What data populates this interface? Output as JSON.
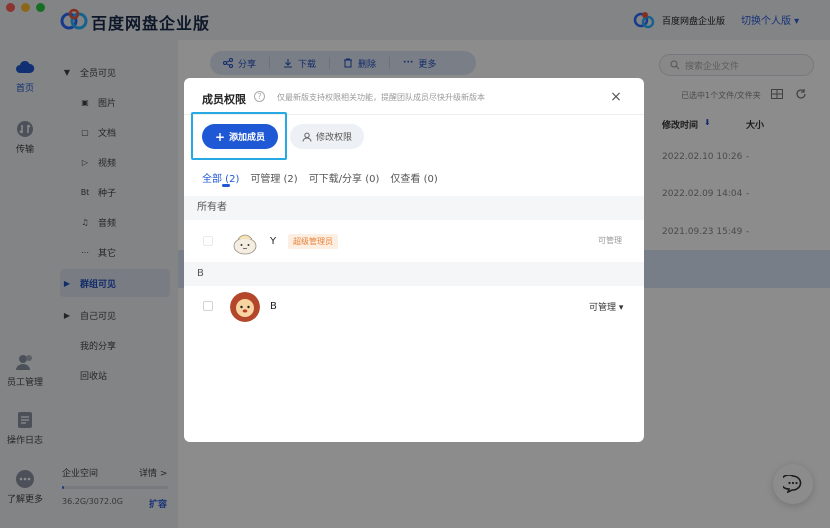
{
  "app": {
    "title": "百度网盘企业版",
    "enterprise_name": "百度网盘企业版",
    "switch_label": "切换个人版 ▾"
  },
  "rail": [
    {
      "label": "首页",
      "icon": "cloud-icon"
    },
    {
      "label": "传输",
      "icon": "transfer-icon"
    },
    {
      "label": "员工管理",
      "icon": "staff-icon"
    },
    {
      "label": "操作日志",
      "icon": "log-icon"
    },
    {
      "label": "了解更多",
      "icon": "more-icon"
    }
  ],
  "sidebar": {
    "items": [
      {
        "label": "全员可见",
        "icon": "caret-down-icon"
      },
      {
        "label": "图片",
        "icon": "image-icon"
      },
      {
        "label": "文档",
        "icon": "document-icon"
      },
      {
        "label": "视频",
        "icon": "video-icon"
      },
      {
        "label": "种子",
        "icon": "torrent-icon"
      },
      {
        "label": "音频",
        "icon": "audio-icon"
      },
      {
        "label": "其它",
        "icon": "other-icon"
      },
      {
        "label": "群组可见",
        "icon": "caret-right-icon"
      },
      {
        "label": "自己可见",
        "icon": "caret-right-icon"
      },
      {
        "label": "我的分享",
        "icon": ""
      },
      {
        "label": "回收站",
        "icon": ""
      }
    ],
    "quota_label": "企业空间",
    "quota_detail": "详情 >",
    "quota_value": "36.2G/3072.0G",
    "quota_fraction": 0.012,
    "expand_label": "扩容"
  },
  "toolbar": {
    "share": "分享",
    "download": "下载",
    "delete": "删除",
    "more": "更多"
  },
  "search": {
    "placeholder": "搜索企业文件"
  },
  "file_list": {
    "selection_info": "已选中1个文件/文件夹",
    "col_modified": "修改时间",
    "col_size": "大小",
    "rows": [
      {
        "date": "2022.02.10 10:26",
        "size": "-"
      },
      {
        "date": "2022.02.09 14:04",
        "size": "-"
      },
      {
        "date": "2021.09.23 15:49",
        "size": "-"
      }
    ]
  },
  "dialog": {
    "title": "成员权限",
    "help": "?",
    "note": "仅最新版支持权限相关功能，提醒团队成员尽快升级新版本",
    "close": "×",
    "add_member": "添加成员",
    "modify_permission": "修改权限",
    "tabs": [
      {
        "label": "全部 (2)"
      },
      {
        "label": "可管理 (2)"
      },
      {
        "label": "可下载/分享 (0)"
      },
      {
        "label": "仅查看 (0)"
      }
    ],
    "owner_group": "所有者",
    "owner": {
      "name": "Y",
      "badge": "超级管理员",
      "role": "可管理"
    },
    "member_group": "B",
    "member": {
      "name": "B",
      "role": "可管理 ▾"
    }
  },
  "colors": {
    "accent": "#1f58d4",
    "focus_ring": "#27a9e3",
    "badge_text": "#e8823a"
  }
}
